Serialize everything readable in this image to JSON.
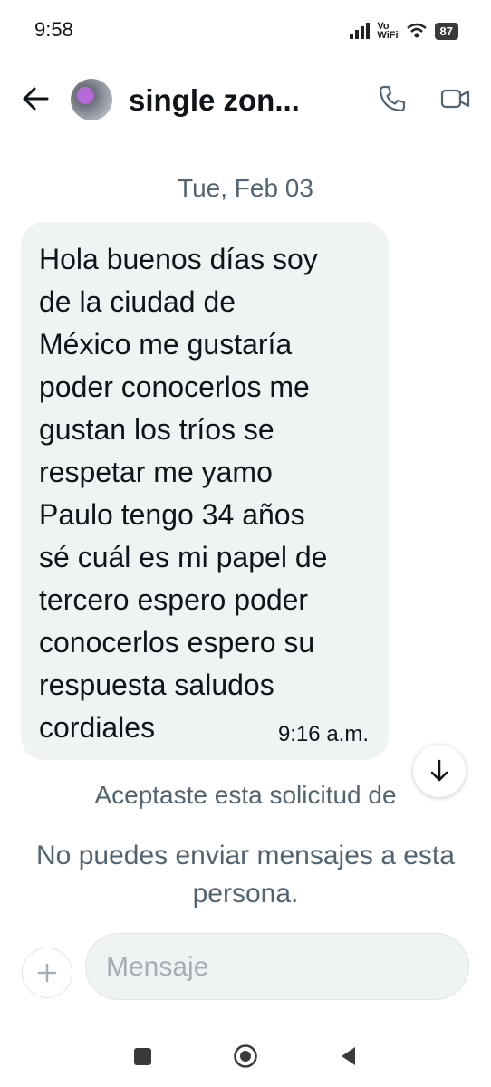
{
  "status_bar": {
    "time": "9:58",
    "network_label_top": "Vo",
    "network_label_bottom": "WiFi",
    "battery": "87"
  },
  "header": {
    "title": "single zon...",
    "icons": [
      "back-arrow-icon",
      "avatar",
      "phone-icon",
      "video-camera-icon"
    ]
  },
  "conversation": {
    "date_separator": "Tue, Feb 03",
    "messages": [
      {
        "text": "Hola buenos días soy\nde la ciudad de\nMéxico me gustaría\npoder conocerlos me\ngustan los tríos se\nrespetar me yamo\nPaulo tengo 34 años\nsé cuál es mi papel de\ntercero espero poder\nconocerlos espero su\nrespuesta saludos\ncordiales",
        "time": "9:16 a.m."
      }
    ]
  },
  "notices": {
    "accepted": "Aceptaste esta solicitud de",
    "cannot_send": "No puedes enviar mensajes a esta persona."
  },
  "composer": {
    "placeholder": "Mensaje"
  },
  "colors": {
    "bubble_bg": "#eff3f4",
    "secondary_text": "#536471",
    "primary_text": "#0f1419"
  }
}
